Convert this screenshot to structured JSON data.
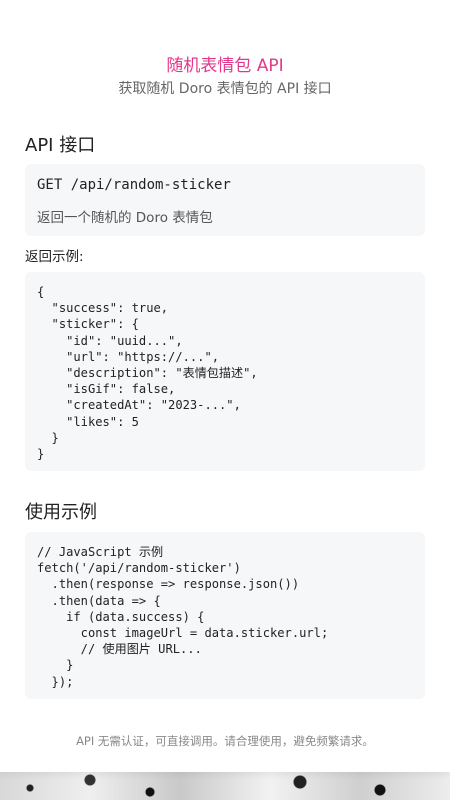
{
  "header": {
    "title": "随机表情包 API",
    "subtitle": "获取随机 Doro 表情包的 API 接口"
  },
  "api_section": {
    "heading": "API 接口",
    "endpoint": "GET /api/random-sticker",
    "description": "返回一个随机的 Doro 表情包",
    "response_label": "返回示例:",
    "response_code": "{\n  \"success\": true,\n  \"sticker\": {\n    \"id\": \"uuid...\",\n    \"url\": \"https://...\",\n    \"description\": \"表情包描述\",\n    \"isGif\": false,\n    \"createdAt\": \"2023-...\",\n    \"likes\": 5\n  }\n}"
  },
  "usage_section": {
    "heading": "使用示例",
    "code": "// JavaScript 示例\nfetch('/api/random-sticker')\n  .then(response => response.json())\n  .then(data => {\n    if (data.success) {\n      const imageUrl = data.sticker.url;\n      // 使用图片 URL...\n    }\n  });"
  },
  "footer": {
    "note": "API 无需认证，可直接调用。请合理使用，避免频繁请求。"
  },
  "colors": {
    "accent": "#e2388c",
    "code_bg": "#f6f7f9"
  }
}
